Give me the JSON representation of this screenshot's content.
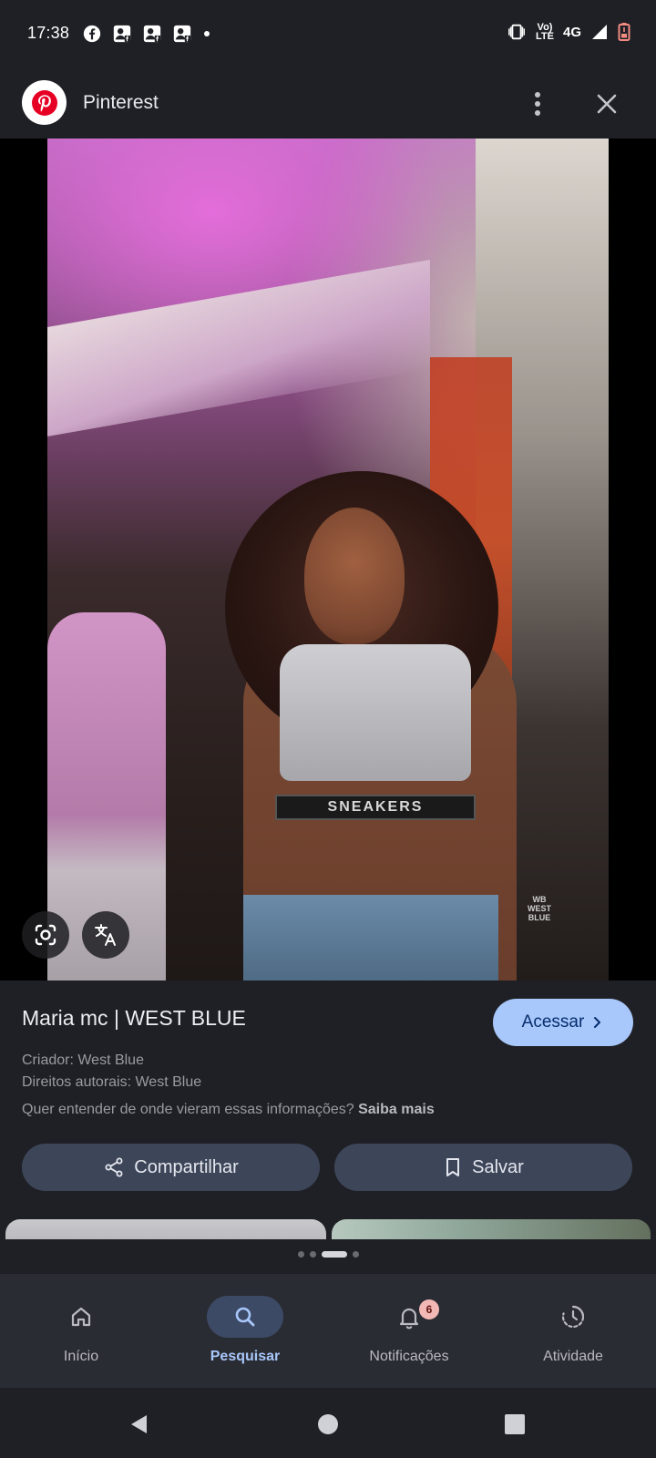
{
  "status_bar": {
    "time": "17:38",
    "network_top": "Vo)",
    "network_bottom": "LTE",
    "signal_label": "4G",
    "icons": [
      "facebook-icon",
      "facebook-avatar-icon",
      "facebook-avatar-icon",
      "facebook-avatar-icon",
      "dot-icon",
      "vibrate-icon",
      "signal-icon",
      "battery-low-icon"
    ]
  },
  "header": {
    "app_name": "Pinterest"
  },
  "photo": {
    "band_text": "SNEAKERS",
    "watermark": "WB WEST BLUE"
  },
  "info": {
    "title": "Maria mc | WEST BLUE",
    "visit_label": "Acessar",
    "creator": "Criador: West Blue",
    "rights": "Direitos autorais: West Blue",
    "question": "Quer entender de onde vieram essas informações?",
    "learn_more": "Saiba mais"
  },
  "actions": {
    "share_label": "Compartilhar",
    "save_label": "Salvar"
  },
  "carousel": {
    "dot_count": 4,
    "active_index": 2
  },
  "bottom_nav": {
    "items": [
      {
        "label": "Início",
        "icon": "home-icon"
      },
      {
        "label": "Pesquisar",
        "icon": "search-icon",
        "active": true
      },
      {
        "label": "Notificações",
        "icon": "bell-icon",
        "badge": "6"
      },
      {
        "label": "Atividade",
        "icon": "activity-icon"
      }
    ]
  },
  "colors": {
    "background": "#1f2025",
    "accent": "#a8c7fa",
    "button_bg": "#3d4659",
    "nav_bg": "#2a2c33",
    "pinterest_red": "#e60023"
  }
}
